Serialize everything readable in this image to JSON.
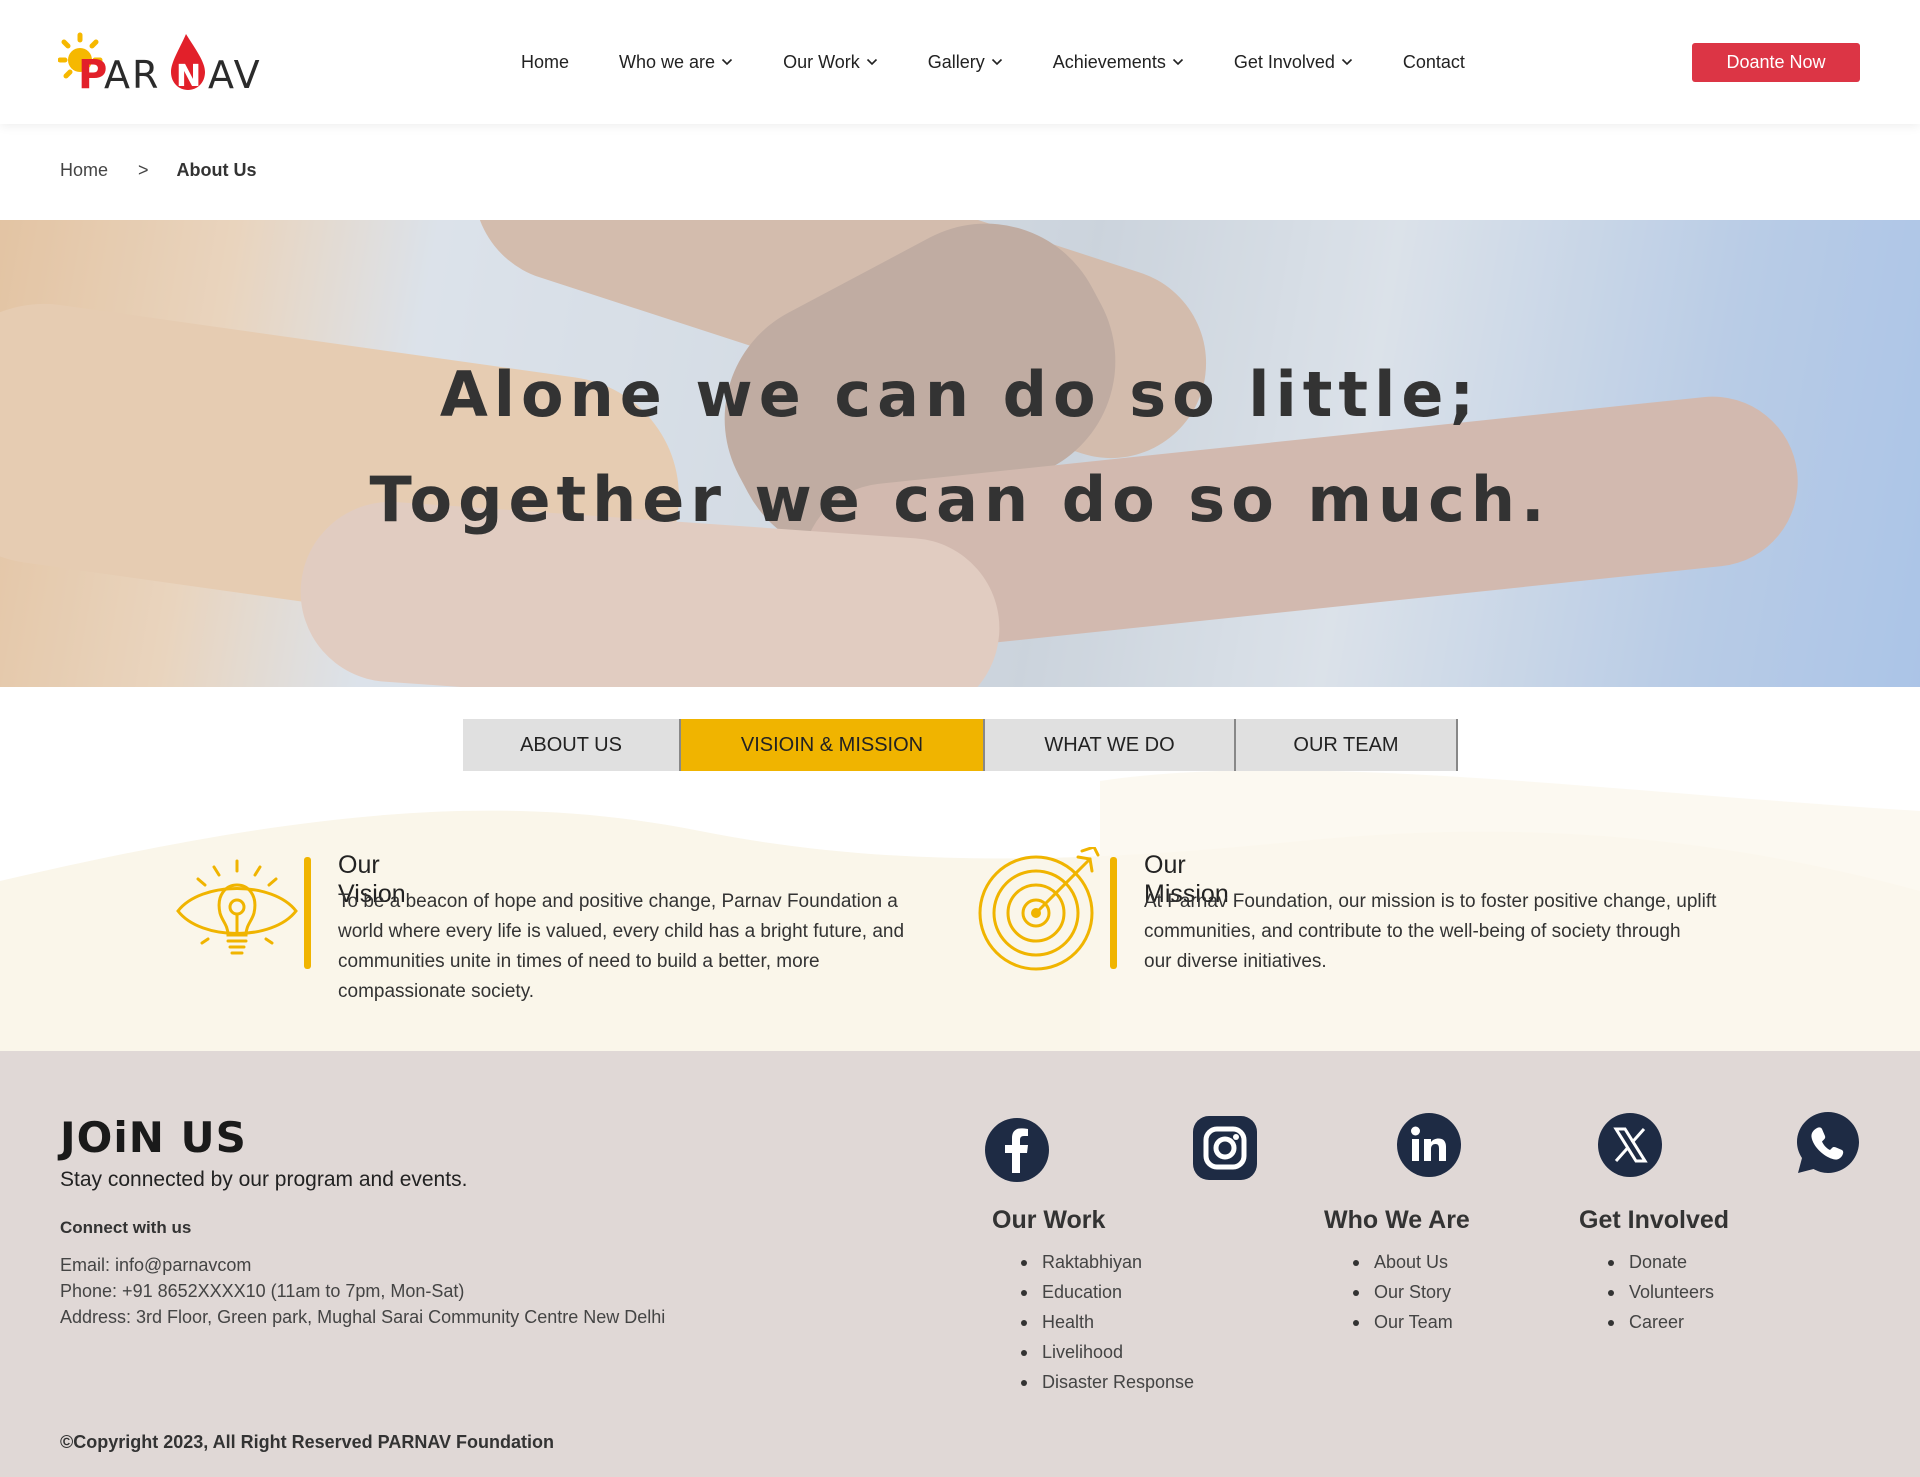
{
  "brand": {
    "name": "PARNAV",
    "colors": {
      "accent": "#f0b400",
      "donate": "#dc3545",
      "footer_bg": "#e0d8d6",
      "logo_red": "#e2202a",
      "logo_dark": "#2b2b2b"
    }
  },
  "nav": {
    "items": [
      {
        "label": "Home",
        "dropdown": false
      },
      {
        "label": "Who we are",
        "dropdown": true
      },
      {
        "label": "Our Work",
        "dropdown": true
      },
      {
        "label": "Gallery",
        "dropdown": true
      },
      {
        "label": "Achievements",
        "dropdown": true
      },
      {
        "label": "Get Involved",
        "dropdown": true
      },
      {
        "label": "Contact",
        "dropdown": false
      }
    ],
    "donate_label": "Doante Now"
  },
  "breadcrumb": {
    "home": "Home",
    "separator": ">",
    "current": "About Us"
  },
  "hero": {
    "line1": "Alone we can do so little;",
    "line2": "Together we can do so much."
  },
  "tabs": [
    {
      "label": "ABOUT US",
      "active": false
    },
    {
      "label": "VISIOIN & MISSION",
      "active": true
    },
    {
      "label": "WHAT WE DO",
      "active": false
    },
    {
      "label": "OUR TEAM",
      "active": false
    }
  ],
  "vision": {
    "icon": "lightbulb-eye-icon",
    "title": "Our Vision",
    "lines": [
      "To be a beacon of hope and positive change, Parnav Foundation a",
      "world where every life is valued, every child has a bright future, and",
      "communities unite in times of need to build a better, more",
      "compassionate society."
    ]
  },
  "mission": {
    "icon": "target-arrow-icon",
    "title": "Our Mission",
    "lines": [
      "At Parnav Foundation, our mission is to foster positive change, uplift",
      "communities, and contribute to the well-being of society through",
      "our diverse initiatives."
    ]
  },
  "footer": {
    "join_title": "JOiN US",
    "join_subtitle": "Stay connected by our program and events.",
    "connect_label": "Connect with us",
    "email": "Email: info@parnavcom",
    "phone": "Phone: +91 8652XXXX10 (11am to 7pm, Mon-Sat)",
    "address": "Address: 3rd Floor, Green park, Mughal Sarai Community Centre New Delhi",
    "social": [
      "facebook-icon",
      "instagram-icon",
      "linkedin-icon",
      "x-twitter-icon",
      "whatsapp-icon"
    ],
    "columns": [
      {
        "title": "Our Work",
        "items": [
          "Raktabhiyan",
          "Education",
          "Health",
          "Livelihood",
          "Disaster Response"
        ]
      },
      {
        "title": "Who We Are",
        "items": [
          "About Us",
          "Our Story",
          "Our Team"
        ]
      },
      {
        "title": "Get Involved",
        "items": [
          "Donate",
          "Volunteers",
          "Career"
        ]
      }
    ],
    "copyright": "©Copyright 2023, All Right Reserved PARNAV Foundation"
  }
}
